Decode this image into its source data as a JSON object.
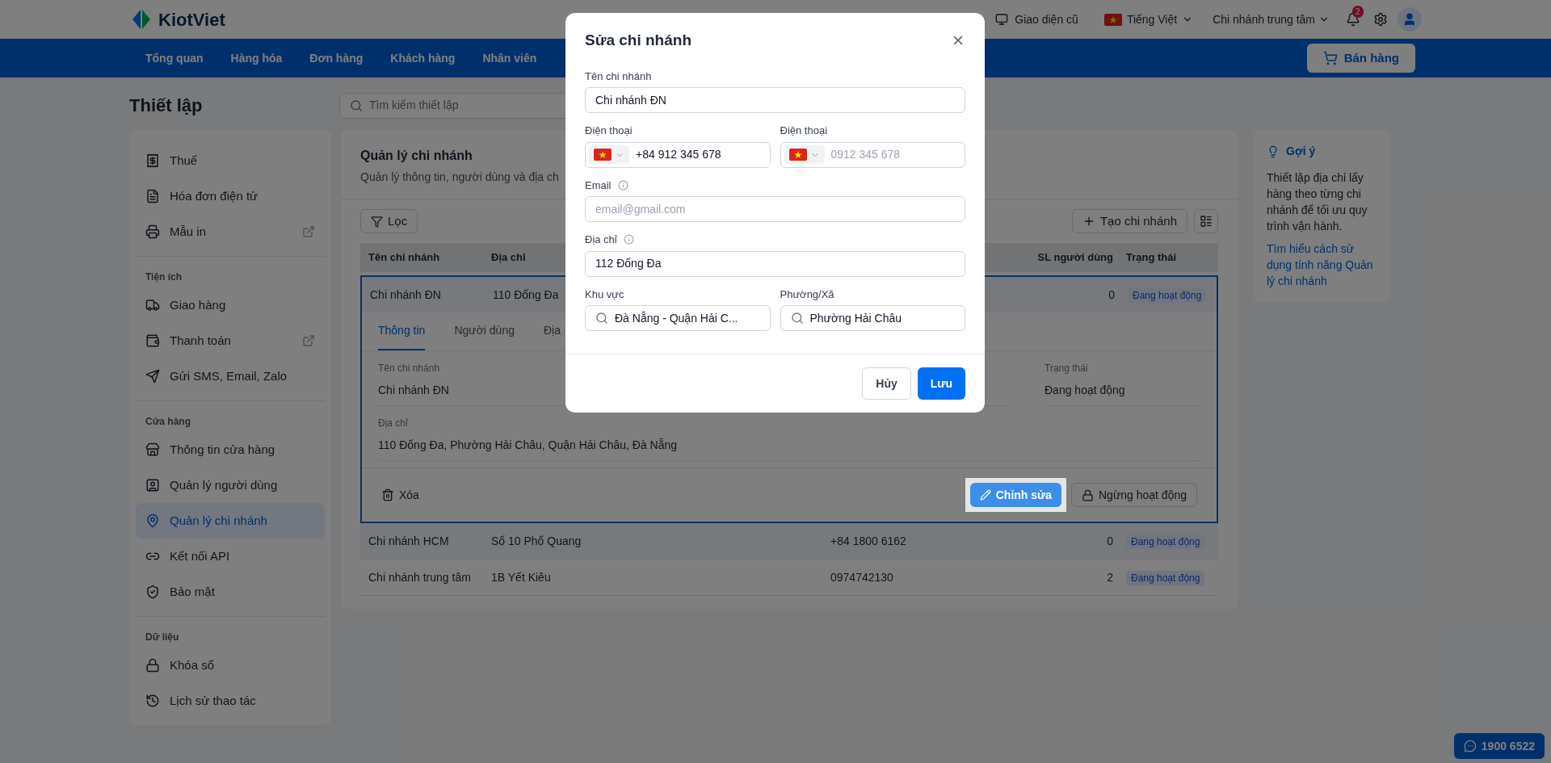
{
  "topbar": {
    "logo": "KiotViet",
    "links": [
      {
        "label": "Giao diện cũ"
      }
    ],
    "language": "Tiếng Việt",
    "branch": "Chi nhánh trung tâm",
    "notifications": "2"
  },
  "nav": {
    "items": [
      "Tổng quan",
      "Hàng hóa",
      "Đơn hàng",
      "Khách hàng",
      "Nhân viên"
    ],
    "sell_button": "Bán hàng"
  },
  "page_title": "Thiết lập",
  "search": {
    "placeholder": "Tìm kiếm thiết lập"
  },
  "sidebar": {
    "sections": [
      {
        "items": [
          {
            "label": "Thuế",
            "selected": false,
            "external": false
          },
          {
            "label": "Hóa đơn điện tử",
            "selected": false,
            "external": false
          },
          {
            "label": "Mẫu in",
            "selected": false,
            "external": true
          }
        ]
      },
      {
        "title": "Tiện ích",
        "items": [
          {
            "label": "Giao hàng",
            "selected": false,
            "external": false
          },
          {
            "label": "Thanh toán",
            "selected": false,
            "external": true
          },
          {
            "label": "Gửi SMS, Email, Zalo",
            "selected": false,
            "external": false
          }
        ]
      },
      {
        "title": "Cửa hàng",
        "items": [
          {
            "label": "Thông tin cửa hàng",
            "selected": false,
            "external": false
          },
          {
            "label": "Quản lý người dùng",
            "selected": false,
            "external": false
          },
          {
            "label": "Quản lý chi nhánh",
            "selected": true,
            "external": false
          },
          {
            "label": "Kết nối API",
            "selected": false,
            "external": false
          },
          {
            "label": "Bảo mật",
            "selected": false,
            "external": false
          }
        ]
      },
      {
        "title": "Dữ liệu",
        "items": [
          {
            "label": "Khóa sổ",
            "selected": false,
            "external": false
          },
          {
            "label": "Lịch sử thao tác",
            "selected": false,
            "external": false
          }
        ]
      }
    ]
  },
  "main": {
    "title": "Quản lý chi nhánh",
    "subtitle": "Quản lý thông tin, người dùng và địa ch",
    "filter_button": "Lọc",
    "create_button": "Tạo chi nhánh",
    "table": {
      "columns": [
        "Tên chi nhánh",
        "Địa chỉ",
        "SL người dùng",
        "Trạng thái"
      ],
      "rows": [
        {
          "name": "Chi nhánh ĐN",
          "address": "110 Đống Đa",
          "users": "0",
          "status": "Đang hoạt động",
          "expanded": true,
          "detail": {
            "tabs": [
              {
                "label": "Thông tin",
                "selected": true
              },
              {
                "label": "Người dùng",
                "selected": false
              },
              {
                "label": "Địa",
                "selected": false
              }
            ],
            "fields": [
              {
                "label": "Tên chi nhánh",
                "value": "Chi nhánh ĐN"
              },
              {
                "label": "Trạng thái",
                "value": "Đang hoạt động"
              },
              {
                "label": "Địa chỉ",
                "value": "110 Đống Đa, Phường Hải Châu, Quận Hải Châu, Đà Nẵng"
              }
            ],
            "delete_button": "Xóa",
            "edit_button": "Chỉnh sửa",
            "deactivate_button": "Ngừng hoạt động"
          }
        },
        {
          "name": "Chi nhánh HCM",
          "address": "Số 10 Phổ Quang",
          "phone": "+84 1800 6162",
          "users": "0",
          "status": "Đang hoạt động",
          "expanded": false
        },
        {
          "name": "Chi nhánh trung tâm",
          "address": "1B Yết Kiêu",
          "phone": "0974742130",
          "users": "2",
          "status": "Đang hoạt động",
          "expanded": false
        }
      ]
    }
  },
  "hint": {
    "title": "Gợi ý",
    "text": "Thiết lập địa chỉ lấy hàng theo từng chi nhánh để tối ưu quy trình vận hành.",
    "link": "Tìm hiểu cách sử dụng tính năng Quản lý chi nhánh"
  },
  "hotline": "1900 6522",
  "modal": {
    "title": "Sửa chi nhánh",
    "name": {
      "label": "Tên chi nhánh",
      "value": "Chi nhánh ĐN"
    },
    "phones": [
      {
        "label": "Điện thoại",
        "value": "+84 912 345 678"
      },
      {
        "label": "Điện thoại",
        "placeholder": "0912 345 678"
      }
    ],
    "email": {
      "label": "Email",
      "placeholder": "email@gmail.com"
    },
    "address": {
      "label": "Địa chỉ",
      "value": "112 Đống Đa"
    },
    "area": {
      "label": "Khu vực",
      "value": "Đà Nẵng - Quận Hải C..."
    },
    "ward": {
      "label": "Phường/Xã",
      "value": "Phường Hải Châu"
    },
    "cancel_button": "Hủy",
    "save_button": "Lưu"
  }
}
